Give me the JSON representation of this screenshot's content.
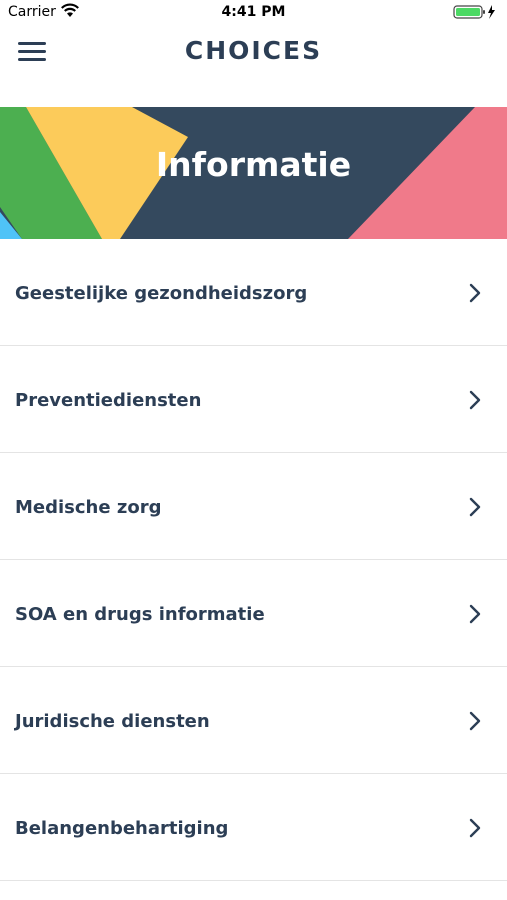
{
  "status_bar": {
    "carrier": "Carrier",
    "time": "4:41 PM"
  },
  "nav": {
    "title": "CHOICES",
    "menu_icon": "hamburger-icon"
  },
  "banner": {
    "title": "Informatie"
  },
  "menu": {
    "items": [
      {
        "label": "Geestelijke gezondheidszorg"
      },
      {
        "label": "Preventiediensten"
      },
      {
        "label": "Medische zorg"
      },
      {
        "label": "SOA en drugs informatie"
      },
      {
        "label": "Juridische diensten"
      },
      {
        "label": "Belangenbehartiging"
      }
    ]
  },
  "colors": {
    "navy": "#34495e",
    "green": "#4caf50",
    "yellow": "#fccb5a",
    "pink": "#f07a8a",
    "blue": "#4fc3f7",
    "text": "#2c3e55"
  }
}
